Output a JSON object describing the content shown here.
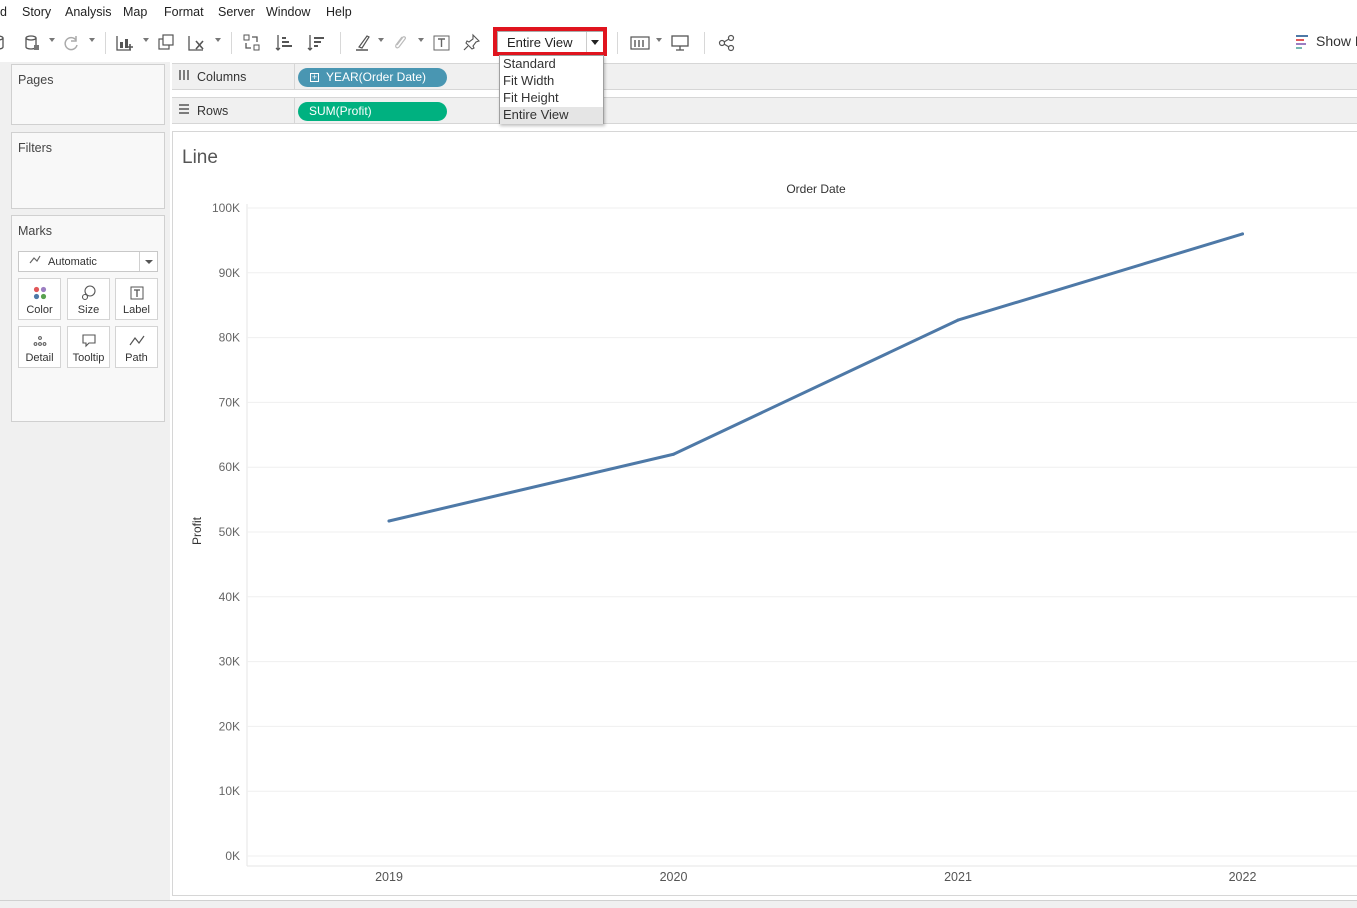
{
  "menu": [
    "d",
    "Story",
    "Analysis",
    "Map",
    "Format",
    "Server",
    "Window",
    "Help"
  ],
  "toolbar": {
    "fit_value": "Entire View",
    "fit_options": [
      {
        "label": "Standard",
        "selected": false
      },
      {
        "label": "Fit Width",
        "selected": false
      },
      {
        "label": "Fit Height",
        "selected": false
      },
      {
        "label": "Entire View",
        "selected": true
      }
    ],
    "show_me_label": "Show M",
    "highlight_color": "#e0141e"
  },
  "cards": {
    "pages": "Pages",
    "filters": "Filters",
    "marks": "Marks",
    "mark_type": "Automatic",
    "mark_buttons": [
      {
        "label": "Color",
        "icon": "color-icon"
      },
      {
        "label": "Size",
        "icon": "size-icon"
      },
      {
        "label": "Label",
        "icon": "label-icon"
      },
      {
        "label": "Detail",
        "icon": "detail-icon"
      },
      {
        "label": "Tooltip",
        "icon": "tooltip-icon"
      },
      {
        "label": "Path",
        "icon": "path-icon"
      }
    ]
  },
  "shelves": {
    "columns_label": "Columns",
    "columns_pill": "YEAR(Order Date)",
    "columns_pill_color": "#4996b2",
    "rows_label": "Rows",
    "rows_pill": "SUM(Profit)",
    "rows_pill_color": "#00b180"
  },
  "chart_data": {
    "type": "line",
    "title": "Line",
    "x_header": "Order Date",
    "ylabel": "Profit",
    "categories": [
      "2019",
      "2020",
      "2021",
      "2022"
    ],
    "series": [
      {
        "values": [
          51700,
          62000,
          82700,
          96000
        ]
      }
    ],
    "ylim": [
      0,
      100000
    ],
    "yticks": [
      0,
      10000,
      20000,
      30000,
      40000,
      50000,
      60000,
      70000,
      80000,
      90000,
      100000
    ],
    "ytick_labels": [
      "0K",
      "10K",
      "20K",
      "30K",
      "40K",
      "50K",
      "60K",
      "70K",
      "80K",
      "90K",
      "100K"
    ],
    "line_color": "#4e79a7",
    "grid": true
  }
}
